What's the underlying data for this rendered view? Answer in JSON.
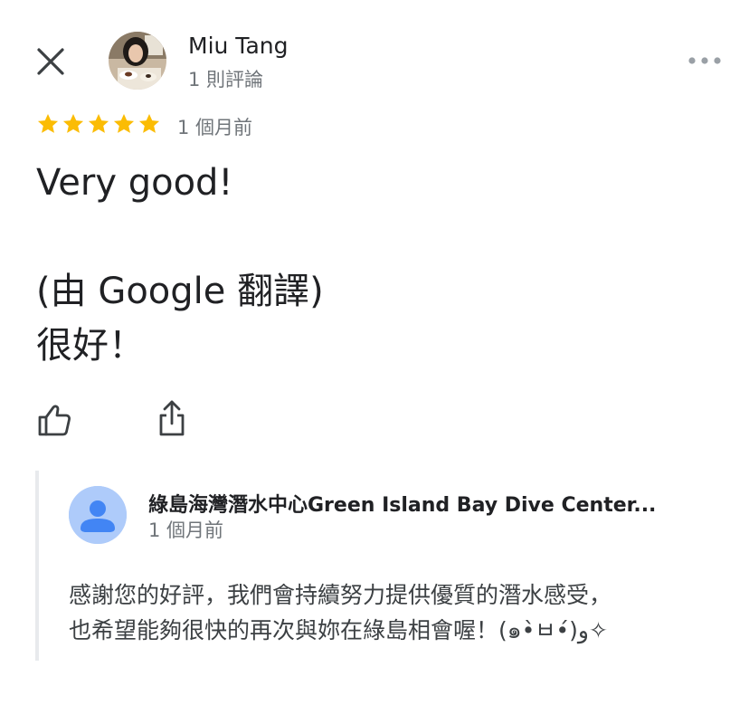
{
  "header": {
    "reviewer_name": "Miu Tang",
    "review_count": "1 則評論",
    "close_icon": "close-icon",
    "more_icon": "more-horizontal-icon"
  },
  "review": {
    "rating": 5,
    "max_rating": 5,
    "star_color": "#fbbc04",
    "date": "1 個月前",
    "text_line_1": "Very good!",
    "translated_label": "(由 Google 翻譯)",
    "translated_text": "很好！"
  },
  "actions": {
    "like_icon": "thumb-up-icon",
    "share_icon": "share-icon"
  },
  "owner_response": {
    "name": "綠島海灣潛水中心Green Island Bay Dive Center...",
    "date": "1 個月前",
    "text_line_1": "感謝您的好評，我們會持續努力提供優質的潛水感受，",
    "text_line_2": "也希望能夠很快的再次與妳在綠島相會喔！(๑•̀ㅂ•́)و✧",
    "avatar_color": "#aecbfa",
    "avatar_icon": "person-icon"
  }
}
